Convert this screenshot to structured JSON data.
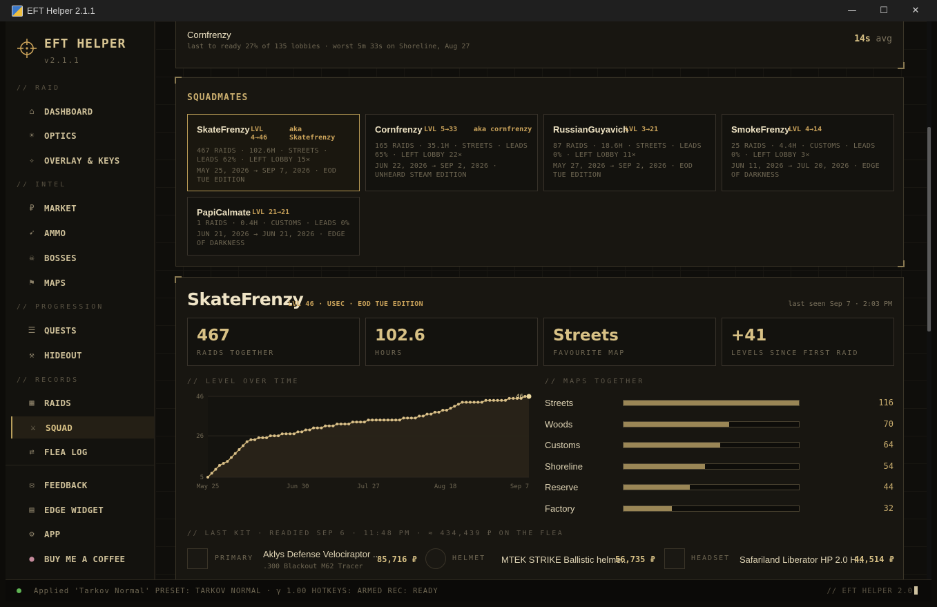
{
  "window": {
    "title": "EFT Helper 2.1.1",
    "minimize": "—",
    "maximize": "☐",
    "close": "✕"
  },
  "sidebar": {
    "brand": "EFT HELPER",
    "version": "v2.1.1",
    "sections": {
      "raid": "// RAID",
      "intel": "// INTEL",
      "progression": "// PROGRESSION",
      "records": "// RECORDS"
    },
    "items": {
      "dashboard": {
        "icon": "home-icon",
        "label": "DASHBOARD"
      },
      "optics": {
        "icon": "sun-icon",
        "label": "OPTICS"
      },
      "overlay": {
        "icon": "diamond-icon",
        "label": "OVERLAY & KEYS"
      },
      "market": {
        "icon": "ruble-icon",
        "label": "MARKET"
      },
      "ammo": {
        "icon": "bullet-icon",
        "label": "AMMO"
      },
      "bosses": {
        "icon": "skull-icon",
        "label": "BOSSES"
      },
      "maps": {
        "icon": "flag-icon",
        "label": "MAPS"
      },
      "quests": {
        "icon": "list-icon",
        "label": "QUESTS"
      },
      "hideout": {
        "icon": "tools-icon",
        "label": "HIDEOUT"
      },
      "raids": {
        "icon": "grid-icon",
        "label": "RAIDS"
      },
      "squad": {
        "icon": "swords-icon",
        "label": "SQUAD"
      },
      "flea_log": {
        "icon": "swap-icon",
        "label": "FLEA LOG"
      },
      "feedback": {
        "icon": "mail-icon",
        "label": "FEEDBACK"
      },
      "edge_widget": {
        "icon": "widget-icon",
        "label": "EDGE WIDGET"
      },
      "app": {
        "icon": "gear-icon",
        "label": "APP"
      },
      "coffee": {
        "icon": "coffee-icon",
        "label": "BUY ME A COFFEE"
      }
    }
  },
  "top_card": {
    "name": "Cornfrenzy",
    "detail": "last to ready 27% of 135 lobbies · worst 5m 33s on Shoreline, Aug 27",
    "avg_value": "14s",
    "avg_label": "avg"
  },
  "squadmates": {
    "title": "SQUADMATES",
    "cards": [
      {
        "name": "SkateFrenzy",
        "level": "LVL 4→46",
        "aka": "aka Skatefrenzy",
        "stats": "467 RAIDS · 102.6H · STREETS · LEADS 62% · LEFT LOBBY 15×",
        "dates": "MAY 25, 2026 → SEP 7, 2026 · EOD TUE EDITION"
      },
      {
        "name": "Cornfrenzy",
        "level": "LVL 5→33",
        "aka": "aka cornfrenzy",
        "stats": "165 RAIDS · 35.1H · STREETS · LEADS 65% · LEFT LOBBY 22×",
        "dates": "JUN 22, 2026 → SEP 2, 2026 · UNHEARD STEAM EDITION"
      },
      {
        "name": "RussianGuyavich",
        "level": "LVL 3→21",
        "aka": "",
        "stats": "87 RAIDS · 18.6H · STREETS · LEADS 0% · LEFT LOBBY 11×",
        "dates": "MAY 27, 2026 → SEP 2, 2026 · EOD TUE EDITION"
      },
      {
        "name": "SmokeFrenzy",
        "level": "LVL 4→14",
        "aka": "",
        "stats": "25 RAIDS · 4.4H · CUSTOMS · LEADS 0% · LEFT LOBBY 3×",
        "dates": "JUN 11, 2026 → JUL 20, 2026 · EDGE OF DARKNESS"
      },
      {
        "name": "PapiCalmate",
        "level": "LVL 21→21",
        "aka": "",
        "stats": "1 RAIDS · 0.4H · CUSTOMS · LEADS 0%",
        "dates": "JUN 21, 2026 → JUN 21, 2026 · EDGE OF DARKNESS"
      }
    ]
  },
  "player": {
    "name": "SkateFrenzy",
    "meta": "LVL 46 · USEC · EOD TUE EDITION",
    "last_seen": "last seen Sep 7 · 2:03 PM",
    "stats": [
      {
        "value": "467",
        "label": "RAIDS TOGETHER"
      },
      {
        "value": "102.6",
        "label": "HOURS"
      },
      {
        "value": "Streets",
        "label": "FAVOURITE MAP"
      },
      {
        "value": "+41",
        "label": "LEVELS SINCE FIRST RAID"
      }
    ],
    "level_heading": "// LEVEL OVER TIME",
    "maps_heading": "// MAPS TOGETHER",
    "maps": [
      {
        "name": "Streets",
        "count": 116
      },
      {
        "name": "Woods",
        "count": 70
      },
      {
        "name": "Customs",
        "count": 64
      },
      {
        "name": "Shoreline",
        "count": 54
      },
      {
        "name": "Reserve",
        "count": 44
      },
      {
        "name": "Factory",
        "count": 32
      }
    ],
    "maps_max": 116
  },
  "chart_data": {
    "type": "line",
    "title": "",
    "xlabel": "",
    "ylabel": "",
    "x_ticks": [
      "May 25",
      "Jun 30",
      "Jul 27",
      "Aug 18",
      "Sep 7"
    ],
    "y_ticks": [
      5,
      26,
      46
    ],
    "ylim": [
      5,
      46
    ],
    "end_label": "46",
    "series": [
      {
        "values": [
          5,
          7,
          9,
          11,
          12,
          13,
          15,
          17,
          19,
          21,
          23,
          24,
          24,
          25,
          25,
          25,
          26,
          26,
          26,
          27,
          27,
          27,
          27,
          28,
          28,
          29,
          29,
          30,
          30,
          30,
          31,
          31,
          31,
          32,
          32,
          32,
          32,
          33,
          33,
          33,
          33,
          34,
          34,
          34,
          34,
          34,
          34,
          34,
          34,
          34,
          35,
          35,
          35,
          35,
          36,
          36,
          37,
          37,
          38,
          38,
          39,
          39,
          40,
          41,
          42,
          43,
          43,
          43,
          43,
          43,
          43,
          44,
          44,
          44,
          44,
          44,
          44,
          45,
          45,
          45,
          45,
          46,
          46
        ]
      }
    ]
  },
  "last_kit": {
    "heading": "// LAST KIT · READIED SEP 6 · 11:48 PM · ≈ 434,439 ₽ ON THE FLEA",
    "items": [
      {
        "slot": "PRIMARY",
        "name": "Aklys Defense Velociraptor ...",
        "sub": ".300 Blackout M62 Tracer",
        "price": "85,716 ₽"
      },
      {
        "slot": "HELMET",
        "name": "MTEK STRIKE Ballistic helme...",
        "sub": "",
        "price": "56,735 ₽"
      },
      {
        "slot": "HEADSET",
        "name": "Safariland Liberator HP 2.0 H...",
        "sub": "",
        "price": "44,514 ₽"
      }
    ]
  },
  "statusbar": {
    "text": "Applied 'Tarkov Normal'   PRESET: TARKOV NORMAL · γ 1.00   HOTKEYS: ARMED   REC: READY",
    "right": "// EFT HELPER 2.0"
  },
  "colors": {
    "accent": "#c9a25a",
    "background": "#0f0e0b",
    "panel": "#181611",
    "status_ok": "#5fb354"
  }
}
